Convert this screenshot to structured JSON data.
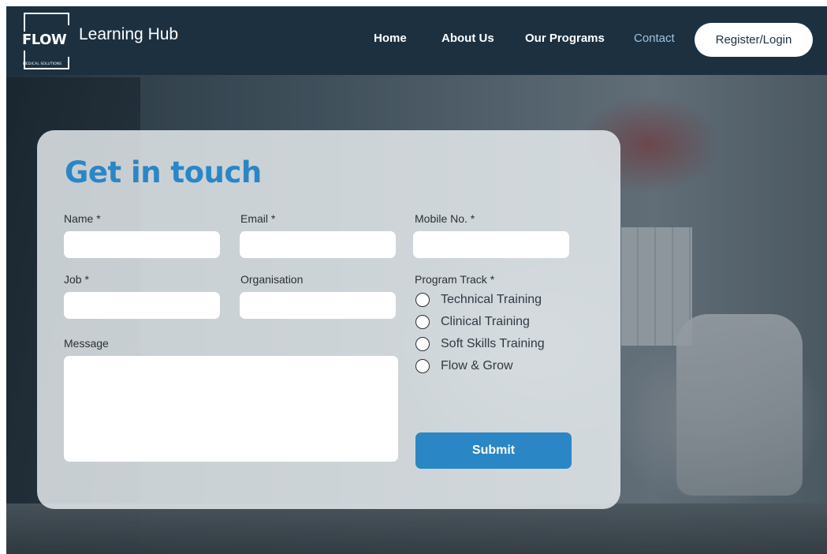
{
  "brand": {
    "logo_word": "FLOW",
    "logo_sub": "MEDICAL SOLUTIONS",
    "title": "Learning Hub"
  },
  "nav": {
    "items": [
      {
        "label": "Home",
        "active": false
      },
      {
        "label": "About Us",
        "active": false
      },
      {
        "label": "Our Programs",
        "active": false
      },
      {
        "label": "Contact",
        "active": true
      }
    ],
    "register_label": "Register/Login"
  },
  "form": {
    "heading": "Get in touch",
    "fields": {
      "name": {
        "label": "Name *",
        "value": ""
      },
      "email": {
        "label": "Email *",
        "value": ""
      },
      "mobile": {
        "label": "Mobile No. *",
        "value": ""
      },
      "job": {
        "label": "Job *",
        "value": ""
      },
      "organisation": {
        "label": "Organisation",
        "value": ""
      },
      "message": {
        "label": "Message",
        "value": ""
      }
    },
    "program_track": {
      "label": "Program Track *",
      "options": [
        "Technical Training",
        "Clinical Training",
        "Soft Skills Training",
        "Flow & Grow"
      ],
      "selected": null
    },
    "submit_label": "Submit"
  },
  "colors": {
    "nav_bg": "#1c3040",
    "accent": "#2b86c6",
    "active_nav": "#9fc3de",
    "card_bg": "#eceff3"
  }
}
